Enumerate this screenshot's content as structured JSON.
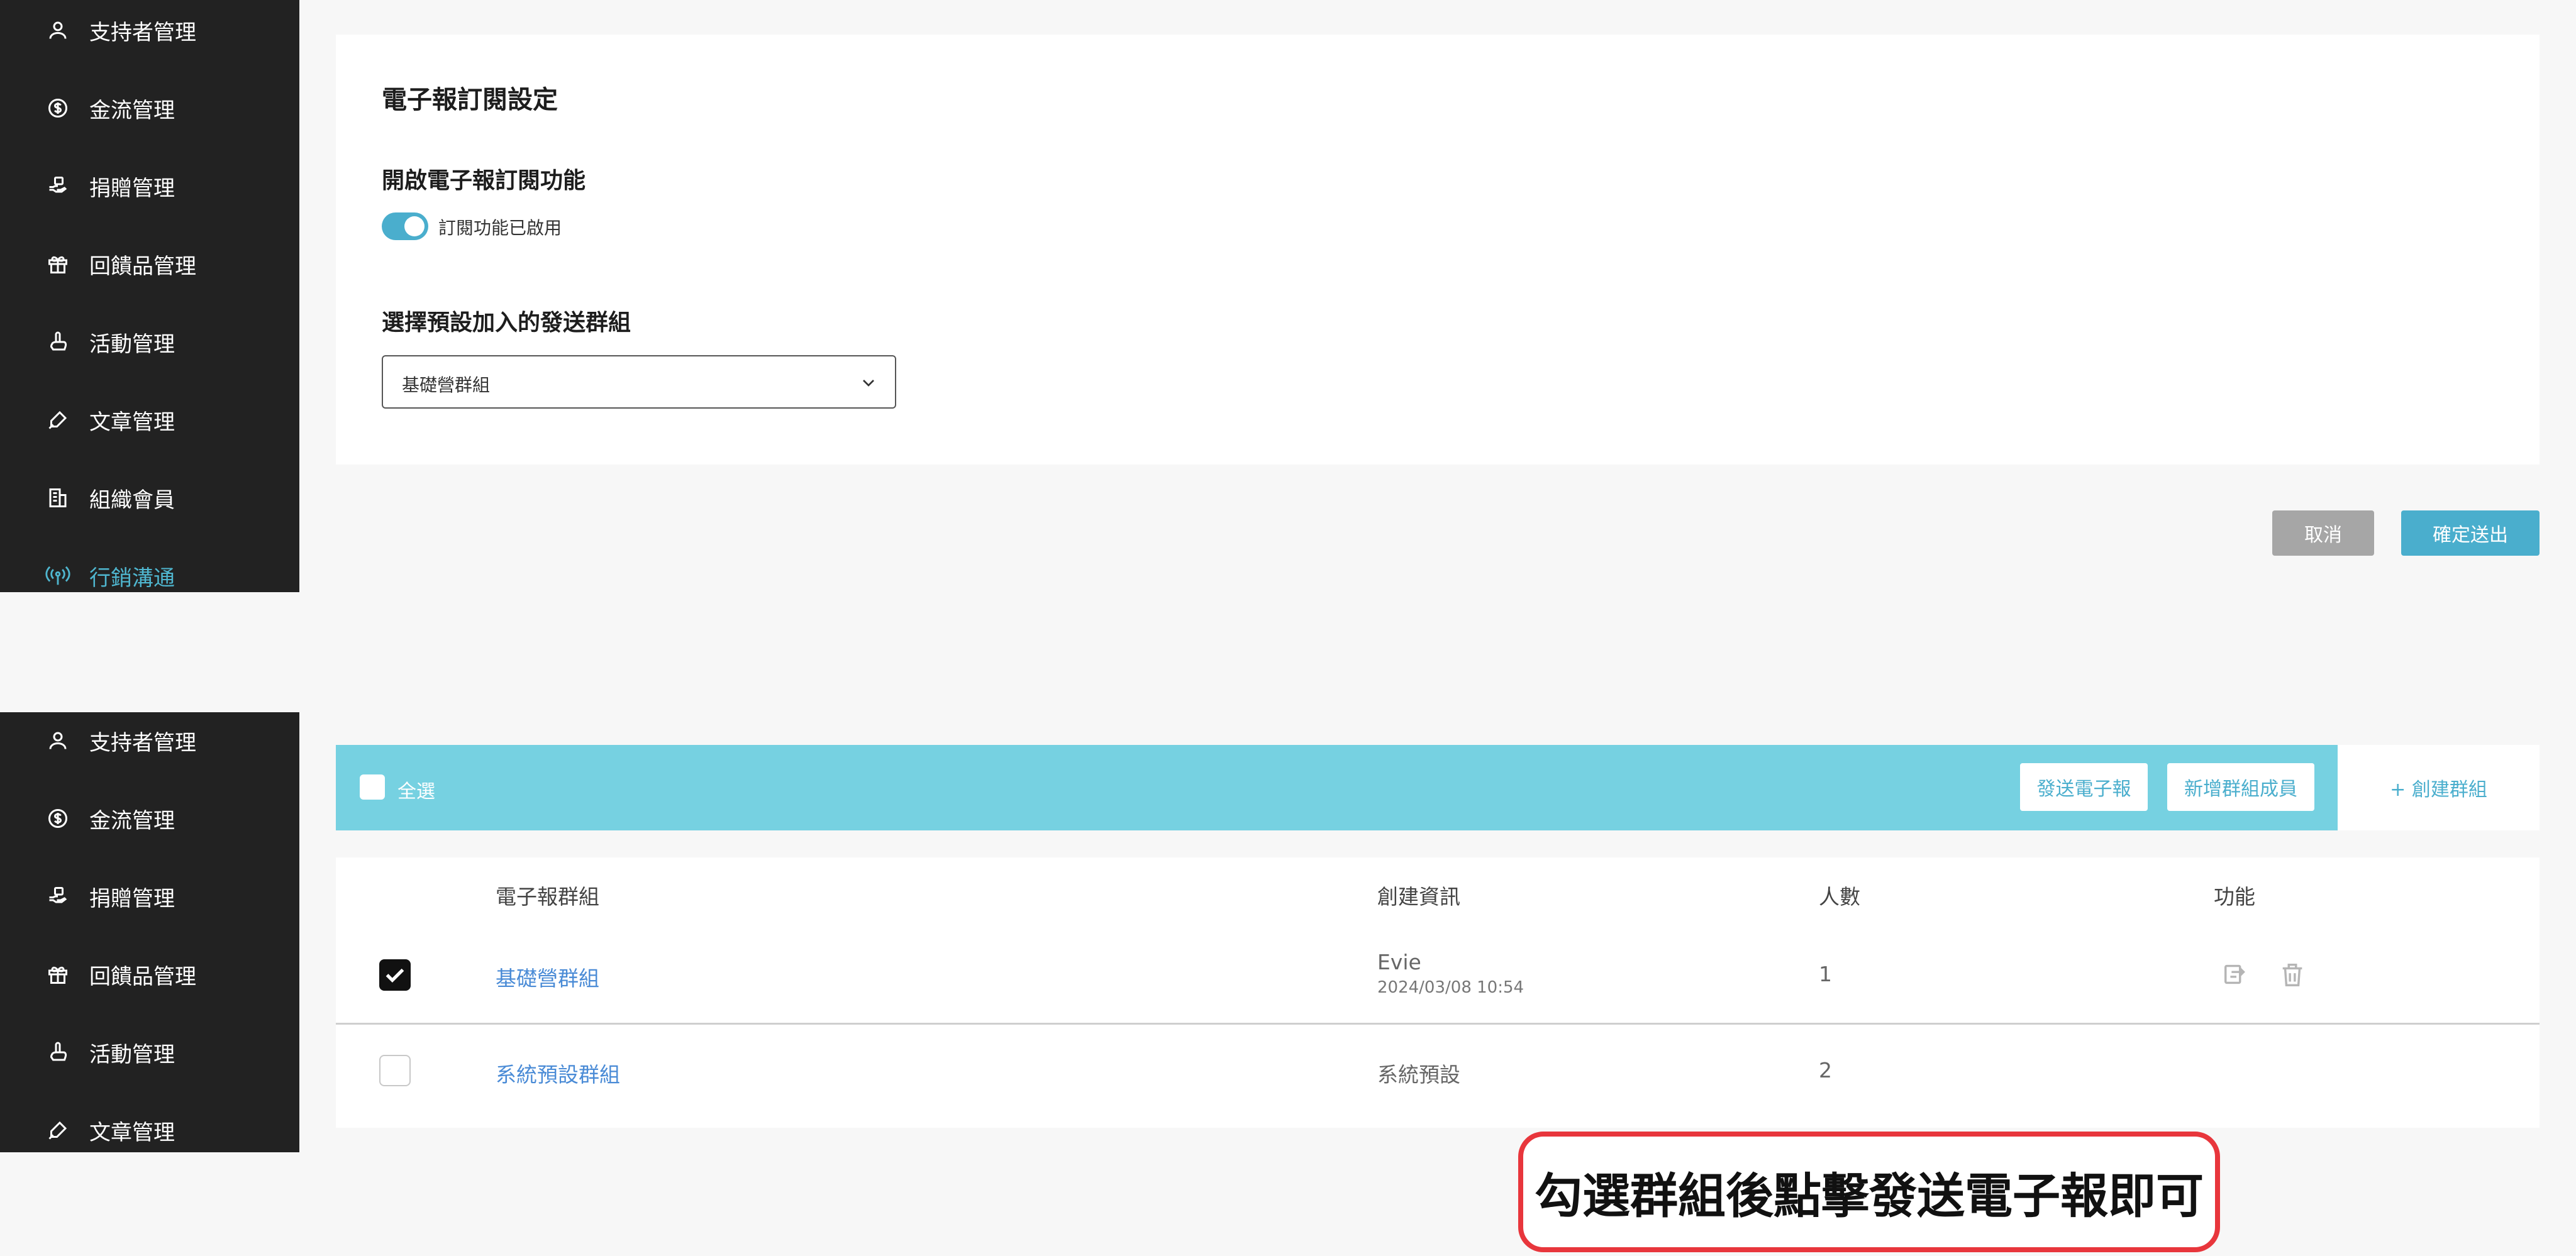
{
  "sidebar_top": {
    "items": [
      {
        "label": "支持者管理",
        "icon": "person-icon"
      },
      {
        "label": "金流管理",
        "icon": "dollar-icon"
      },
      {
        "label": "捐贈管理",
        "icon": "donate-hand-icon"
      },
      {
        "label": "回饋品管理",
        "icon": "gift-icon"
      },
      {
        "label": "活動管理",
        "icon": "hand-pointer-icon"
      },
      {
        "label": "文章管理",
        "icon": "pen-icon"
      },
      {
        "label": "組織會員",
        "icon": "building-icon"
      },
      {
        "label": "行銷溝通",
        "icon": "broadcast-icon",
        "active": true
      }
    ]
  },
  "sidebar_bottom": {
    "items": [
      {
        "label": "支持者管理",
        "icon": "person-icon"
      },
      {
        "label": "金流管理",
        "icon": "dollar-icon"
      },
      {
        "label": "捐贈管理",
        "icon": "donate-hand-icon"
      },
      {
        "label": "回饋品管理",
        "icon": "gift-icon"
      },
      {
        "label": "活動管理",
        "icon": "hand-pointer-icon"
      },
      {
        "label": "文章管理",
        "icon": "pen-icon"
      }
    ]
  },
  "settings": {
    "title": "電子報訂閱設定",
    "enable_heading": "開啟電子報訂閱功能",
    "toggle_label": "訂閱功能已啟用",
    "toggle_on": true,
    "group_heading": "選擇預設加入的發送群組",
    "group_select_value": "基礎營群組"
  },
  "actions": {
    "cancel": "取消",
    "confirm": "確定送出"
  },
  "toolbar": {
    "select_all": "全選",
    "send_newsletter": "發送電子報",
    "add_member": "新增群組成員",
    "create_group": "+ 創建群組"
  },
  "table": {
    "headers": {
      "group": "電子報群組",
      "created": "創建資訊",
      "count": "人數",
      "actions": "功能"
    },
    "rows": [
      {
        "checked": true,
        "group": "基礎營群組",
        "creator": "Evie",
        "created_at": "2024/03/08 10:54",
        "count": "1"
      },
      {
        "checked": false,
        "group": "系統預設群組",
        "creator": "系統預設",
        "created_at": "",
        "count": "2"
      }
    ]
  },
  "callout": "勾選群組後點擊發送電子報即可",
  "colors": {
    "sidebar_bg": "#222222",
    "accent": "#4aaecd",
    "toolbar_bg": "#76d1e1",
    "callout_border": "#e8363c"
  }
}
